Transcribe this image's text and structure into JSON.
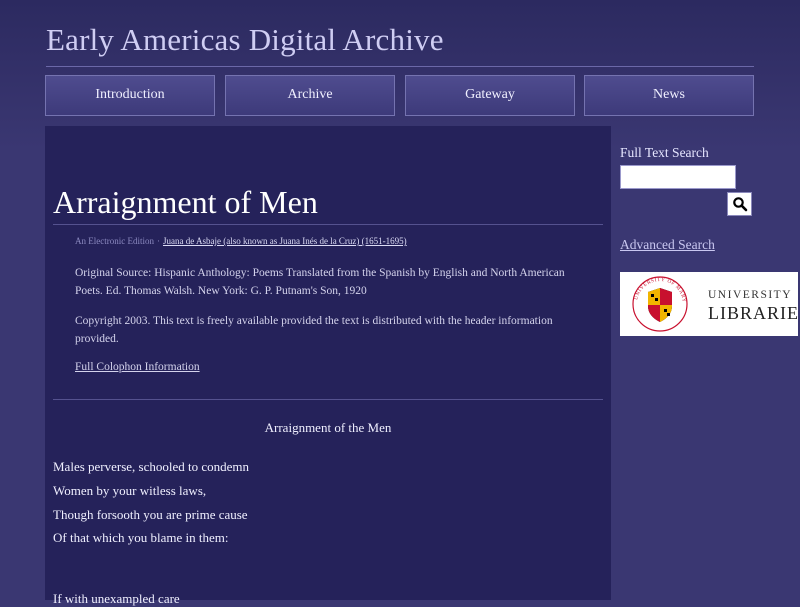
{
  "site": {
    "title": "Early Americas Digital Archive"
  },
  "nav": {
    "items": [
      "Introduction",
      "Archive",
      "Gateway",
      "News"
    ]
  },
  "article": {
    "title": "Arraignment of Men",
    "edition_label": "An Electronic Edition",
    "separator": "·",
    "author": "Juana de Asbaje (also known as Juana Inés de la Cruz) (1651-1695)",
    "source": "Original Source: Hispanic Anthology: Poems Translated from the Spanish by English and North American Poets. Ed. Thomas Walsh. New York: G. P. Putnam's Son, 1920",
    "copyright": "Copyright 2003. This text is freely available provided the text is distributed with the header information provided.",
    "colophon_link": "Full Colophon Information"
  },
  "poem": {
    "title": "Arraignment of the Men",
    "lines": [
      "Males perverse, schooled to condemn",
      "Women by your witless laws,",
      "Though forsooth you are prime cause",
      "Of that which you blame in them:",
      "If with unexampled care"
    ]
  },
  "sidebar": {
    "search_label": "Full Text Search",
    "search_value": "",
    "advanced_search": "Advanced Search",
    "logo": {
      "seal_text": "UNIVERSITY OF MARYLAND",
      "line1": "UNIVERSITY",
      "line2": "LIBRARIES"
    }
  },
  "colors": {
    "page_bg": "#3a3772",
    "content_bg": "#25225a",
    "nav_button": "#4a4789",
    "maryland_red": "#c8102e",
    "maryland_gold": "#f2b500"
  }
}
